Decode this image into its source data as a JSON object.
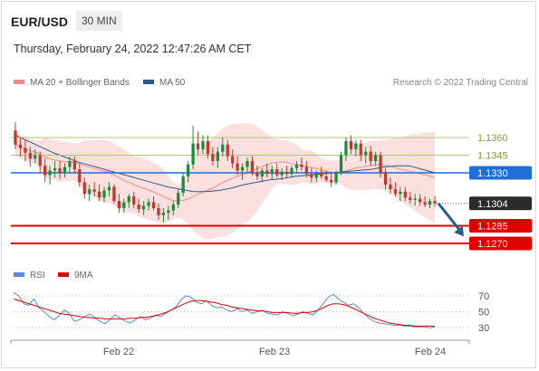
{
  "header": {
    "symbol": "EUR/USD",
    "timeframe": "30 MIN",
    "datetime": "Thursday, February 24, 2022 12:47:26 AM CET"
  },
  "legend": {
    "items": [
      {
        "label": "MA 20 + Bollinger Bands",
        "color": "#f08c8c"
      },
      {
        "label": "MA 50",
        "color": "#2d5a8c"
      }
    ],
    "credit": "Research © 2022 Trading Central"
  },
  "chart_data": [
    {
      "type": "candlestick",
      "ylim": [
        1.126,
        1.14
      ],
      "x_ticks": [
        "Feb 22",
        "Feb 23",
        "Feb 24"
      ],
      "candles": [
        [
          1.1366,
          1.1373,
          1.135,
          1.1354
        ],
        [
          1.1354,
          1.136,
          1.1344,
          1.1351
        ],
        [
          1.1351,
          1.1358,
          1.134,
          1.1347
        ],
        [
          1.1347,
          1.1352,
          1.1335,
          1.1342
        ],
        [
          1.1342,
          1.135,
          1.1338,
          1.1345
        ],
        [
          1.1345,
          1.1348,
          1.133,
          1.1336
        ],
        [
          1.1336,
          1.1342,
          1.1322,
          1.1328
        ],
        [
          1.1328,
          1.1336,
          1.132,
          1.1332
        ],
        [
          1.1332,
          1.134,
          1.1326,
          1.1334
        ],
        [
          1.1334,
          1.134,
          1.1325,
          1.133
        ],
        [
          1.133,
          1.1338,
          1.1326,
          1.1335
        ],
        [
          1.1335,
          1.1344,
          1.133,
          1.134
        ],
        [
          1.134,
          1.1344,
          1.133,
          1.1333
        ],
        [
          1.1333,
          1.1338,
          1.1318,
          1.1322
        ],
        [
          1.1322,
          1.1326,
          1.1308,
          1.1312
        ],
        [
          1.1312,
          1.132,
          1.1306,
          1.1316
        ],
        [
          1.1316,
          1.1322,
          1.131,
          1.1314
        ],
        [
          1.1314,
          1.132,
          1.1306,
          1.1309
        ],
        [
          1.1309,
          1.1318,
          1.1305,
          1.1315
        ],
        [
          1.1315,
          1.1322,
          1.131,
          1.1318
        ],
        [
          1.1318,
          1.132,
          1.1304,
          1.1306
        ],
        [
          1.1306,
          1.1312,
          1.1296,
          1.13
        ],
        [
          1.13,
          1.1308,
          1.1296,
          1.1305
        ],
        [
          1.1305,
          1.1312,
          1.13,
          1.131
        ],
        [
          1.131,
          1.1314,
          1.13,
          1.1303
        ],
        [
          1.1303,
          1.1308,
          1.1296,
          1.1299
        ],
        [
          1.1299,
          1.1306,
          1.1294,
          1.1302
        ],
        [
          1.1302,
          1.1308,
          1.1298,
          1.1305
        ],
        [
          1.1305,
          1.131,
          1.1298,
          1.13
        ],
        [
          1.13,
          1.1304,
          1.129,
          1.1294
        ],
        [
          1.1294,
          1.13,
          1.1288,
          1.1296
        ],
        [
          1.1296,
          1.1302,
          1.129,
          1.1298
        ],
        [
          1.1298,
          1.1306,
          1.1294,
          1.1303
        ],
        [
          1.1303,
          1.1316,
          1.13,
          1.1313
        ],
        [
          1.1313,
          1.133,
          1.131,
          1.1327
        ],
        [
          1.1327,
          1.134,
          1.1322,
          1.1337
        ],
        [
          1.1337,
          1.137,
          1.1333,
          1.1355
        ],
        [
          1.1355,
          1.1365,
          1.1345,
          1.135
        ],
        [
          1.135,
          1.1362,
          1.1346,
          1.1357
        ],
        [
          1.1357,
          1.1362,
          1.1342,
          1.1346
        ],
        [
          1.1346,
          1.1352,
          1.1336,
          1.134
        ],
        [
          1.134,
          1.1352,
          1.1334,
          1.1348
        ],
        [
          1.1348,
          1.136,
          1.1344,
          1.1354
        ],
        [
          1.1354,
          1.1358,
          1.134,
          1.1344
        ],
        [
          1.1344,
          1.135,
          1.1334,
          1.1338
        ],
        [
          1.1338,
          1.1344,
          1.1328,
          1.1332
        ],
        [
          1.1332,
          1.1338,
          1.1324,
          1.1335
        ],
        [
          1.1335,
          1.1343,
          1.133,
          1.134
        ],
        [
          1.134,
          1.1344,
          1.1328,
          1.133
        ],
        [
          1.133,
          1.1336,
          1.1324,
          1.1327
        ],
        [
          1.1327,
          1.1334,
          1.1322,
          1.1332
        ],
        [
          1.1332,
          1.1338,
          1.1326,
          1.1329
        ],
        [
          1.1329,
          1.1336,
          1.1324,
          1.1333
        ],
        [
          1.1333,
          1.1338,
          1.1326,
          1.1328
        ],
        [
          1.1328,
          1.1334,
          1.1324,
          1.1331
        ],
        [
          1.1331,
          1.1336,
          1.1326,
          1.1329
        ],
        [
          1.1329,
          1.1336,
          1.1326,
          1.1334
        ],
        [
          1.1334,
          1.134,
          1.133,
          1.1337
        ],
        [
          1.1337,
          1.1343,
          1.1332,
          1.1335
        ],
        [
          1.1335,
          1.134,
          1.1326,
          1.1329
        ],
        [
          1.1329,
          1.1334,
          1.1322,
          1.1326
        ],
        [
          1.1326,
          1.1332,
          1.1322,
          1.133
        ],
        [
          1.133,
          1.1335,
          1.1325,
          1.1327
        ],
        [
          1.1327,
          1.1332,
          1.1322,
          1.1324
        ],
        [
          1.1324,
          1.133,
          1.1318,
          1.1322
        ],
        [
          1.1322,
          1.1332,
          1.132,
          1.133
        ],
        [
          1.133,
          1.1348,
          1.1328,
          1.1345
        ],
        [
          1.1345,
          1.136,
          1.134,
          1.1357
        ],
        [
          1.1357,
          1.1362,
          1.1346,
          1.135
        ],
        [
          1.135,
          1.1358,
          1.1344,
          1.1355
        ],
        [
          1.1355,
          1.1358,
          1.134,
          1.1345
        ],
        [
          1.1345,
          1.1352,
          1.1338,
          1.1348
        ],
        [
          1.1348,
          1.1353,
          1.1336,
          1.134
        ],
        [
          1.134,
          1.1348,
          1.1336,
          1.1345
        ],
        [
          1.1345,
          1.1348,
          1.1326,
          1.133
        ],
        [
          1.133,
          1.1334,
          1.1316,
          1.132
        ],
        [
          1.132,
          1.1326,
          1.1312,
          1.1316
        ],
        [
          1.1316,
          1.1322,
          1.131,
          1.1312
        ],
        [
          1.1312,
          1.1318,
          1.1306,
          1.1314
        ],
        [
          1.1314,
          1.1318,
          1.1306,
          1.1309
        ],
        [
          1.1309,
          1.1314,
          1.1304,
          1.1307
        ],
        [
          1.1307,
          1.1312,
          1.1302,
          1.1308
        ],
        [
          1.1308,
          1.1312,
          1.1302,
          1.1305
        ],
        [
          1.1305,
          1.131,
          1.1301,
          1.1303
        ],
        [
          1.1303,
          1.1308,
          1.13,
          1.1306
        ],
        [
          1.1306,
          1.131,
          1.1301,
          1.1304
        ]
      ],
      "bollinger_ma20": {
        "color": "#f08c8c",
        "band_color": "#fbd9d9"
      },
      "ma50": {
        "color": "#2d5a8c",
        "values": [
          1.1362,
          1.1357,
          1.1352,
          1.1347,
          1.1343,
          1.1339,
          1.1336,
          1.1333,
          1.133,
          1.1327,
          1.1324,
          1.1321,
          1.1318,
          1.1316,
          1.1314,
          1.1314,
          1.1315,
          1.1317,
          1.132,
          1.1322,
          1.1324,
          1.1325,
          1.1327,
          1.1328,
          1.1329,
          1.133,
          1.1331,
          1.1332,
          1.1333,
          1.1335,
          1.1336,
          1.1336,
          1.1333,
          1.133
        ]
      },
      "levels": [
        {
          "value": 1.136,
          "label": "1.1360",
          "style": "resistance-thin",
          "color": "#7aa22c"
        },
        {
          "value": 1.1345,
          "label": "1.1345",
          "style": "resistance-thin",
          "color": "#7aa22c"
        },
        {
          "value": 1.133,
          "label": "1.1330",
          "style": "pivot",
          "color": "#1e6fd8"
        },
        {
          "value": 1.1304,
          "label": "1.1304",
          "style": "last",
          "color": "#2b2b2b"
        },
        {
          "value": 1.1285,
          "label": "1.1285",
          "style": "target",
          "color": "#e00000"
        },
        {
          "value": 1.127,
          "label": "1.1270",
          "style": "target",
          "color": "#e00000"
        }
      ],
      "forecast_arrow": {
        "from": 1.1304,
        "to": 1.1276,
        "color": "#2d5a8c"
      }
    },
    {
      "type": "line",
      "indicator": "RSI",
      "ylim": [
        20,
        80
      ],
      "y_ticks": [
        70,
        50,
        30
      ],
      "legend": [
        {
          "label": "RSI",
          "color": "#5b8be0"
        },
        {
          "label": "9MA",
          "color": "#e00000"
        }
      ],
      "series": [
        {
          "name": "RSI",
          "color": "#5b8be0",
          "values": [
            74,
            70,
            60,
            58,
            66,
            55,
            50,
            44,
            40,
            45,
            52,
            48,
            38,
            40,
            44,
            47,
            43,
            38,
            35,
            40,
            46,
            42,
            38,
            36,
            40,
            44,
            40,
            42,
            46,
            44,
            48,
            52,
            56,
            65,
            70,
            68,
            62,
            60,
            64,
            58,
            55,
            56,
            52,
            50,
            54,
            50,
            52,
            48,
            50,
            52,
            48,
            47,
            46,
            50,
            48,
            45,
            47,
            50,
            48,
            46,
            52,
            60,
            68,
            72,
            66,
            62,
            58,
            60,
            55,
            48,
            42,
            38,
            36,
            35,
            34,
            33,
            33,
            32,
            32,
            31,
            31,
            31,
            30,
            31
          ]
        },
        {
          "name": "9MA",
          "color": "#e00000",
          "values": [
            66,
            64,
            62,
            60,
            58,
            56,
            54,
            52,
            50,
            48,
            47,
            46,
            45,
            44,
            43,
            43,
            42,
            42,
            41,
            41,
            41,
            41,
            41,
            42,
            42,
            43,
            43,
            44,
            45,
            47,
            49,
            52,
            55,
            58,
            61,
            63,
            64,
            64,
            63,
            62,
            61,
            59,
            58,
            56,
            55,
            54,
            53,
            52,
            51,
            51,
            50,
            49,
            49,
            49,
            49,
            48,
            48,
            49,
            49,
            50,
            52,
            55,
            58,
            60,
            60,
            59,
            57,
            54,
            51,
            48,
            45,
            42,
            40,
            38,
            36,
            35,
            34,
            33,
            33,
            32,
            32,
            32,
            32,
            32
          ]
        }
      ]
    }
  ]
}
